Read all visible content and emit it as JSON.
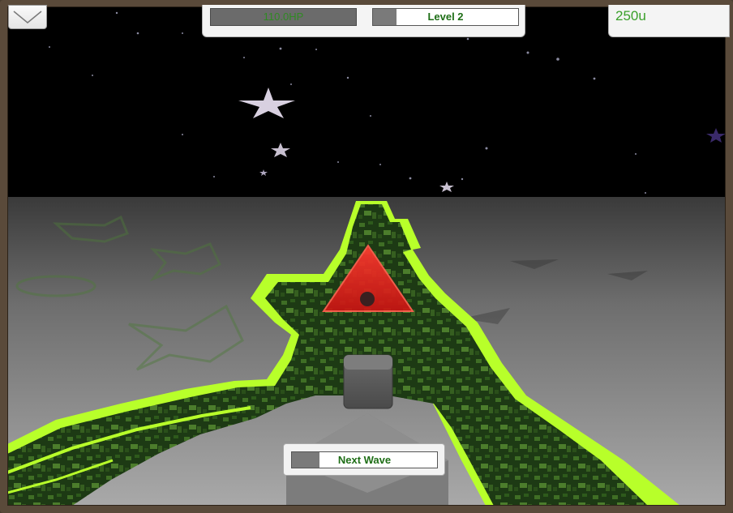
{
  "hud": {
    "health_label": "110.0HP",
    "level_label": "Level 2",
    "level_progress": 0.16,
    "money_label": "250u",
    "next_wave_label": "Next Wave",
    "next_wave_progress": 0.19,
    "menu_icon": "chevron-down-icon"
  },
  "colors": {
    "path_glow": "#b8ff2a",
    "path_fill": "#1f3a16",
    "enemy": "#e0201c",
    "hud_text_green": "#1e6e16",
    "money_green": "#3aa02a",
    "frame": "#5a4a3a"
  }
}
